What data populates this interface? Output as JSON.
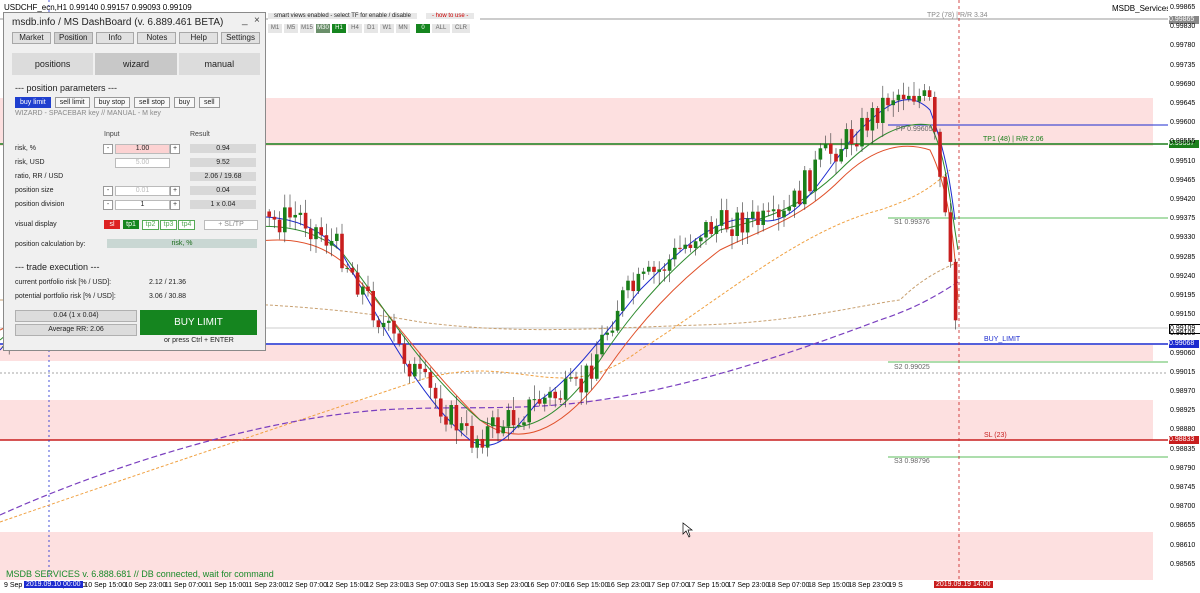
{
  "chart": {
    "symbol_header": "USDCHF_ecn,H1  0.99140 0.99157 0.99093 0.99109",
    "service_label": "MSDB_Services",
    "price_ticks": [
      "0.99865",
      "0.99830",
      "0.99780",
      "0.99735",
      "0.99690",
      "0.99645",
      "0.99600",
      "0.99555",
      "0.99510",
      "0.99465",
      "0.99420",
      "0.99375",
      "0.99330",
      "0.99285",
      "0.99240",
      "0.99195",
      "0.99150",
      "0.99105",
      "0.99060",
      "0.99015",
      "0.98970",
      "0.98925",
      "0.98880",
      "0.98835",
      "0.98790",
      "0.98745",
      "0.98700",
      "0.98655",
      "0.98610",
      "0.98565"
    ],
    "price_tags": {
      "current": "0.99109",
      "buy_limit": "0.99068",
      "tp": "0.99557",
      "sl": "0.98833",
      "top": "0.99865"
    },
    "levels": {
      "tp2": "TP2 (78)  |  R/R 3.34",
      "tp1": "TP1 (48)  |  R/R 2.06",
      "pp": "PP  0.99605",
      "s1": "S1  0.99376",
      "buy_limit": "BUY_LIMIT",
      "s2": "S2  0.99025",
      "sl": "SL (23)",
      "s3": "S3  0.98796"
    },
    "time_ticks": [
      "9 Sep 2",
      "10 Sep 08:00",
      "10 Sep 15:00",
      "10 Sep 23:00",
      "11 Sep 07:00",
      "11 Sep 15:00",
      "11 Sep 23:00",
      "12 Sep 07:00",
      "12 Sep 15:00",
      "12 Sep 23:00",
      "13 Sep 07:00",
      "13 Sep 15:00",
      "13 Sep 23:00",
      "16 Sep 07:00",
      "16 Sep 15:00",
      "16 Sep 23:00",
      "17 Sep 07:00",
      "17 Sep 15:00",
      "17 Sep 23:00",
      "18 Sep 07:00",
      "18 Sep 15:00",
      "18 Sep 23:00",
      "19 S"
    ],
    "time_tags": {
      "left": "2019.09.10 00:00",
      "right": "2019.09.19 14:00"
    },
    "status": "MSDB SERVICES v. 6.888.681 // DB connected, wait for command",
    "colors": {
      "bull": "#1a7f1a",
      "bear": "#c81e1e",
      "blue_line": "#1c2bcf",
      "green_ma": "#2e8b2e",
      "red_ma": "#e0502a",
      "zone": "#fde0e0"
    }
  },
  "toolbar": {
    "smart_text": "smart views enabled - select TF for enable / disable",
    "how_to": "- how to use -",
    "timeframes": [
      "M1",
      "M5",
      "M15",
      "M30",
      "H1",
      "H4",
      "D1",
      "W1",
      "MN"
    ],
    "zero": "0",
    "all": "ALL",
    "clr": "CLR"
  },
  "panel": {
    "title": "msdb.info / MS DashBoard (v. 6.889.461 BETA)",
    "min": "_",
    "close": "×",
    "tabs": [
      "Market",
      "Position",
      "Info",
      "Notes",
      "Help",
      "Settings"
    ],
    "big": [
      "positions",
      "wizard",
      "manual"
    ],
    "params_title": "--- position parameters ---",
    "order_types": [
      "buy limit",
      "sell limit",
      "buy stop",
      "sell stop",
      "buy",
      "sell"
    ],
    "hint": "WIZARD - SPACEBAR key  //  MANUAL - M key",
    "col_input": "Input",
    "col_result": "Result",
    "rows": [
      {
        "label": "risk, %",
        "input": "1.00",
        "result": "0.94"
      },
      {
        "label": "risk, USD",
        "input": "5.00",
        "result": "9.52"
      },
      {
        "label": "ratio, RR / USD",
        "input": "",
        "result": "2.06 / 19.68"
      },
      {
        "label": "position size",
        "input": "0.01",
        "result": "0.04"
      },
      {
        "label": "position division",
        "input": "1",
        "result": "1 x 0.04"
      }
    ],
    "stepper_minus": "-",
    "stepper_plus": "+",
    "visual_label": "visual display",
    "visual": [
      "sl",
      "tp1",
      "tp2",
      "tp3",
      "tp4",
      "+ SL/TP"
    ],
    "calc_label": "position calculation by:",
    "calc_value": "risk, %",
    "exec_title": "--- trade execution ---",
    "current_risk_label": "current portfolio risk [% / USD]:",
    "current_risk_value": "2.12 / 21.36",
    "potential_risk_label": "potential portfolio risk [% / USD]:",
    "potential_risk_value": "3.06 / 30.88",
    "lots": "0.04 (1 x 0.04)",
    "avg_rr": "Average RR: 2.06",
    "buy_button": "BUY LIMIT",
    "ctrl_hint": "or press Ctrl + ENTER"
  }
}
